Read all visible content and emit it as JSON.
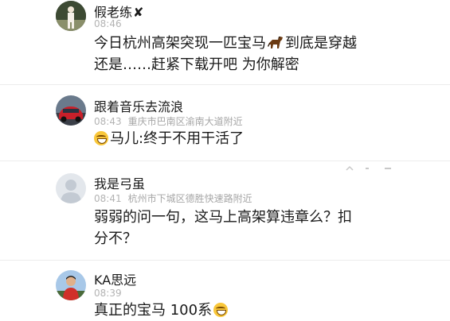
{
  "comments": [
    {
      "username": "假老练",
      "badge": "✘",
      "time": "08:46",
      "location": "",
      "text_line1_a": "今日杭州高架突现一匹宝马",
      "text_line1_b": "到底是穿越",
      "text_line2": "还是……赶紧下载开吧 为你解密"
    },
    {
      "username": "跟着音乐去流浪",
      "time": "08:43",
      "location": "重庆市巴南区渝南大道附近",
      "text": "马儿:终于不用干活了"
    },
    {
      "username": "我是弓虽",
      "time": "08:41",
      "location": "杭州市下城区德胜快速路附近",
      "text_line1": "弱弱的问一句，这马上高架算违章么？扣",
      "text_line2": "分不？"
    },
    {
      "username": "KA思远",
      "time": "08:39",
      "location": "",
      "text": "真正的宝马 100系"
    }
  ],
  "icons": {
    "horse": "horse-icon",
    "grin": "grin-emoji-icon",
    "more": "more-dots-icon"
  }
}
